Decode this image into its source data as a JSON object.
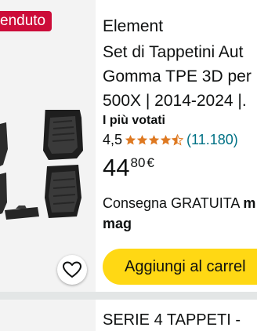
{
  "product": {
    "badge": "enduto",
    "brand": "Element",
    "title_lines": [
      "Set di Tappetini Aut",
      "Gomma TPE 3D per",
      "500X | 2014-2024 |."
    ],
    "best_seller": "I più votati",
    "rating": "4,5",
    "rating_stars": 4.5,
    "review_count": "(11.180)",
    "price_whole": "44",
    "price_fraction": "80",
    "price_currency": "€",
    "delivery_prefix": "Consegna GRATUITA ",
    "delivery_bold": "m",
    "delivery_date": "mag",
    "add_to_cart": "Aggiungi al carrel",
    "icons": [
      "heart-icon",
      "star-icon"
    ]
  },
  "next_product": {
    "title": "SERIE 4 TAPPETI -"
  },
  "colors": {
    "badge": "#cc0c39",
    "star": "#de7921",
    "cart_button": "#ffd814",
    "link": "#007185"
  }
}
